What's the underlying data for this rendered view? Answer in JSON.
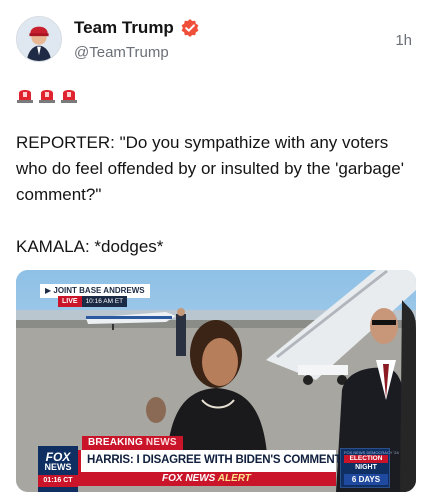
{
  "post": {
    "author_name": "Team Trump",
    "handle": "@TeamTrump",
    "timestamp": "1h",
    "verified_icon": "verified-badge-icon",
    "verified_color": "#f0503a",
    "emoji_icons": [
      "police-siren-icon",
      "police-siren-icon",
      "police-siren-icon"
    ],
    "text_paragraphs": [
      "REPORTER: \"Do you sympathize with any voters who do feel offended by or insulted by the 'garbage' comment?\"",
      "KAMALA: *dodges*"
    ]
  },
  "media": {
    "location": "▶ JOINT BASE ANDREWS",
    "live_label": "LIVE",
    "live_time": "10:16 AM ET",
    "breaking_label_1": "BREAKING ",
    "breaking_label_2": "NEWS",
    "headline": "HARRIS: I DISAGREE WITH BIDEN'S COMMENTS",
    "alert_prefix": "FOX NEWS ",
    "alert_word": "ALERT",
    "network_logo_line1": "FOX",
    "network_logo_line2": "NEWS",
    "network_logo_line3": "01:16 CT",
    "election_small": "FOX NEWS DEMOCRACY '24",
    "election_title": "ELECTION",
    "election_night": "NIGHT",
    "election_days": "6 DAYS"
  },
  "colors": {
    "text_primary": "#141414",
    "text_secondary": "#6b7078",
    "fox_red": "#c9142a",
    "fox_navy": "#0f2f63"
  }
}
